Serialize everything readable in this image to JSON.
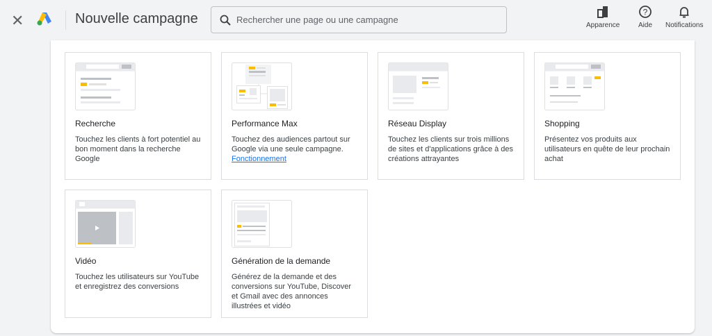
{
  "header": {
    "title": "Nouvelle campagne",
    "search_placeholder": "Rechercher une page ou une campagne",
    "actions": [
      {
        "label": "Apparence",
        "icon": "appearance-icon"
      },
      {
        "label": "Aide",
        "icon": "help-icon"
      },
      {
        "label": "Notifications",
        "icon": "bell-icon"
      }
    ]
  },
  "colors": {
    "accent": "#fbbc04",
    "link": "#1a73e8"
  },
  "cards": [
    {
      "title": "Recherche",
      "desc": "Touchez les clients à fort potentiel au bon moment dans la recherche Google"
    },
    {
      "title": "Performance Max",
      "desc": "Touchez des audiences partout sur Google via une seule campagne. ",
      "link": "Fonctionnement"
    },
    {
      "title": "Réseau Display",
      "desc": "Touchez les clients sur trois millions de sites et d'applications grâce à des créations attrayantes"
    },
    {
      "title": "Shopping",
      "desc": "Présentez vos produits aux utilisateurs en quête de leur prochain achat"
    },
    {
      "title": "Vidéo",
      "desc": "Touchez les utilisateurs sur YouTube et enregistrez des conversions"
    },
    {
      "title": "Génération de la demande",
      "desc": "Générez de la demande et des conversions sur YouTube, Discover et Gmail avec des annonces illustrées et vidéo"
    }
  ]
}
